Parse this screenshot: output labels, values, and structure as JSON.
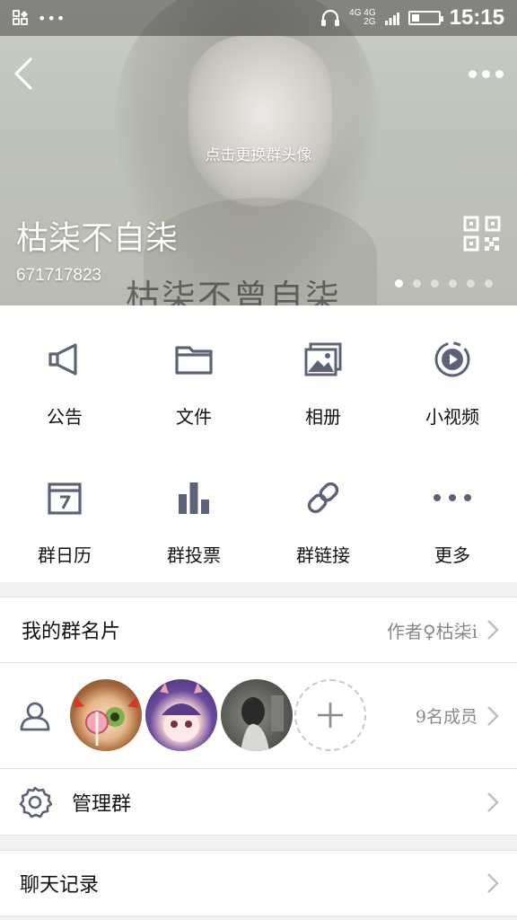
{
  "status_bar": {
    "time": "15:15",
    "network_top": "4G 4G",
    "network_bottom": "2G",
    "battery_level": 0.3
  },
  "header": {
    "change_avatar_text": "点击更换群头像",
    "group_name": "枯柒不自柒",
    "group_id": "671717823",
    "cover_text": "枯柒不曾自柒",
    "page_count": 6,
    "active_page": 0
  },
  "functions": [
    {
      "label": "公告",
      "icon": "megaphone-icon"
    },
    {
      "label": "文件",
      "icon": "folder-icon"
    },
    {
      "label": "相册",
      "icon": "photo-album-icon"
    },
    {
      "label": "小视频",
      "icon": "video-play-icon"
    },
    {
      "label": "群日历",
      "icon": "calendar-icon"
    },
    {
      "label": "群投票",
      "icon": "bar-chart-icon"
    },
    {
      "label": "群链接",
      "icon": "link-icon"
    },
    {
      "label": "更多",
      "icon": "more-dots-icon"
    }
  ],
  "my_card": {
    "label": "我的群名片",
    "value": "作者♀枯柒i"
  },
  "members": {
    "count_label": "9名成员"
  },
  "manage": {
    "label": "管理群"
  },
  "chat_history": {
    "label": "聊天记录"
  },
  "colors": {
    "icon": "#5c6277",
    "chevron": "#bdbdc2",
    "page_bg": "#f2f2f4"
  }
}
